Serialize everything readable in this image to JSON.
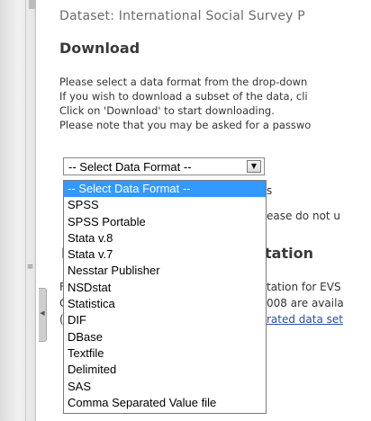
{
  "page": {
    "dataset_title": "Dataset: International Social Survey P",
    "section_heading": "Download",
    "instructions": [
      "Please select a data format from the drop-down",
      "If you wish to download a subset of the data, cli",
      "Click on 'Download' to start downloading.",
      "Please note that you may be asked for a passwo"
    ]
  },
  "format_select": {
    "value": "-- Select Data Format --",
    "arrow_icon": "triangle-down-icon",
    "options": [
      "-- Select Data Format --",
      "SPSS",
      "SPSS Portable",
      "Stata v.8",
      "Stata v.7",
      "Nesstar Publisher",
      "NSDstat",
      "Statistica",
      "DIF",
      "DBase",
      "Textfile",
      "Delimited",
      "SAS",
      "Comma Separated Value file"
    ],
    "selected_index": 0,
    "highlight_color": "#3399ff"
  },
  "obscured": {
    "fragment_s": "s",
    "please_note": "ease do not u",
    "heading_fragment_1": "I",
    "heading_fragment_2": "tation",
    "left_frag_1": "F",
    "left_frag_2": "C",
    "left_frag_3": "(",
    "line_1": "tation for EVS",
    "line_2": "008 are availa",
    "line_3": "rated data set"
  }
}
